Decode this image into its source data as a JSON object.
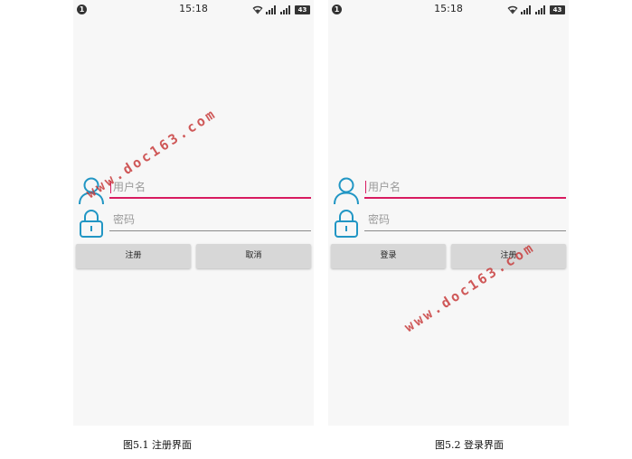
{
  "status_bar": {
    "notification_count": "1",
    "time": "15:18",
    "battery": "43"
  },
  "register_screen": {
    "username_placeholder": "用户名",
    "password_placeholder": "密码",
    "left_button": "注册",
    "right_button": "取消",
    "caption": "图5.1 注册界面"
  },
  "login_screen": {
    "username_placeholder": "用户名",
    "password_placeholder": "密码",
    "left_button": "登录",
    "right_button": "注册",
    "caption": "图5.2 登录界面"
  },
  "watermark": "www.doc163.com",
  "colors": {
    "accent": "#d81b60",
    "icon": "#2196c4",
    "button": "#d7d7d7",
    "screen_bg": "#f7f7f7"
  }
}
